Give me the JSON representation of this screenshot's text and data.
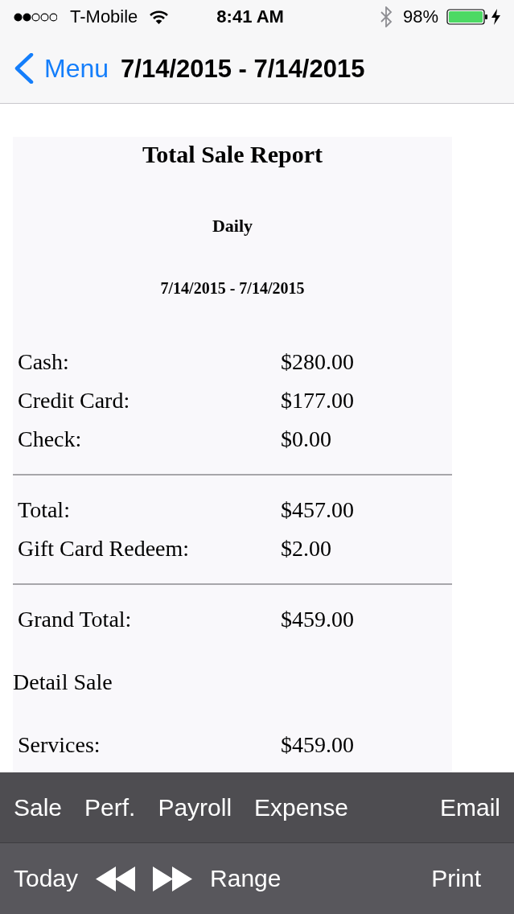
{
  "status_bar": {
    "carrier": "T-Mobile",
    "time": "8:41 AM",
    "battery": "98%"
  },
  "nav_bar": {
    "back_button": "Menu",
    "title": "7/14/2015 - 7/14/2015"
  },
  "report": {
    "title": "Total Sale Report",
    "period": "Daily",
    "date_range": "7/14/2015 - 7/14/2015",
    "lines": [
      {
        "kind": "row",
        "label": "Cash:",
        "value": "$280.00"
      },
      {
        "kind": "row",
        "label": "Credit Card:",
        "value": "$177.00"
      },
      {
        "kind": "row",
        "label": "Check:",
        "value": "$0.00"
      },
      {
        "kind": "divider"
      },
      {
        "kind": "row",
        "label": "Total:",
        "value": "$457.00"
      },
      {
        "kind": "row",
        "label": "Gift Card Redeem:",
        "value": "$2.00"
      },
      {
        "kind": "divider"
      },
      {
        "kind": "row",
        "label": "Grand Total:",
        "value": "$459.00"
      },
      {
        "kind": "heading",
        "label": "Detail Sale"
      },
      {
        "kind": "row",
        "label": "Services:",
        "value": "$459.00"
      }
    ]
  },
  "toolbars": [
    {
      "left": [
        {
          "kind": "text",
          "label": "Sale"
        },
        {
          "kind": "text",
          "label": "Perf."
        },
        {
          "kind": "text",
          "label": "Payroll"
        },
        {
          "kind": "text",
          "label": "Expense"
        }
      ],
      "right": [
        {
          "kind": "text",
          "label": "Email"
        }
      ]
    },
    {
      "left": [
        {
          "kind": "text",
          "label": "Today"
        },
        {
          "kind": "rewind"
        },
        {
          "kind": "fast_forward"
        },
        {
          "kind": "text",
          "label": "Range"
        }
      ],
      "right": [
        {
          "kind": "text",
          "label": "Print"
        }
      ]
    }
  ]
}
